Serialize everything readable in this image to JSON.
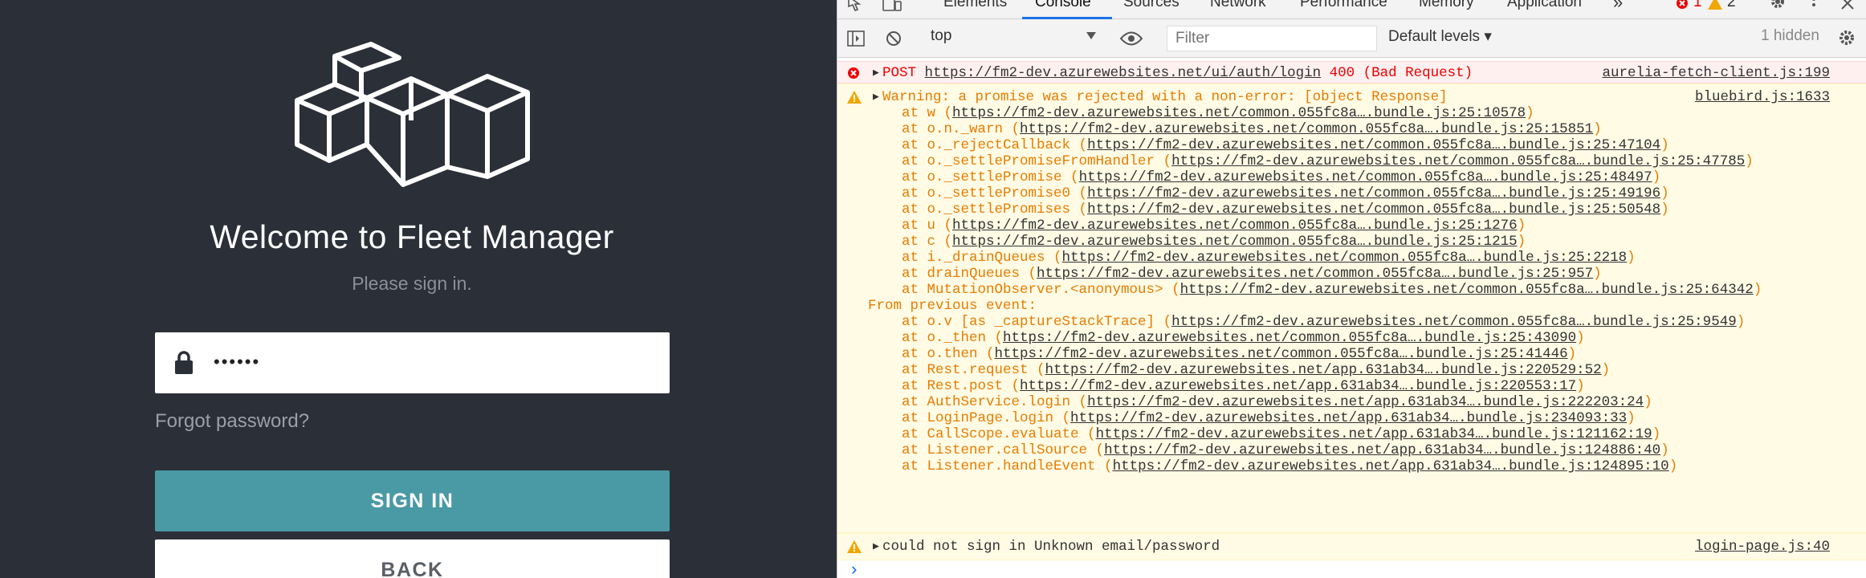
{
  "app": {
    "welcome": "Welcome to Fleet Manager",
    "subtitle": "Please sign in.",
    "password_value": "••••••",
    "forgot_password": "Forgot password?",
    "signin_label": "SIGN IN",
    "back_label": "BACK",
    "colors": {
      "background": "#2b2f37",
      "accent": "#4a9aa5"
    }
  },
  "devtools": {
    "tabs": [
      "Elements",
      "Console",
      "Sources",
      "Network",
      "Performance",
      "Memory",
      "Application"
    ],
    "active_tab": "Console",
    "more_tabs": "»",
    "error_count": "1",
    "warning_count": "2",
    "toolbar": {
      "context": "top",
      "filter_placeholder": "Filter",
      "levels": "Default levels ▾",
      "hidden": "1 hidden"
    },
    "messages": {
      "error1": {
        "method": "POST",
        "url": "https://fm2-dev.azurewebsites.net/ui/auth/login",
        "status": "400 (Bad Request)",
        "source": "aurelia-fetch-client.js:199"
      },
      "warn1": {
        "text": "Warning: a promise was rejected with a non-error: [object Response]",
        "source": "bluebird.js:1633",
        "stack": [
          {
            "fn": "at w",
            "url": "https://fm2-dev.azurewebsites.net/common.055fc8a….bundle.js:25:10578"
          },
          {
            "fn": "at o.n._warn",
            "url": "https://fm2-dev.azurewebsites.net/common.055fc8a….bundle.js:25:15851"
          },
          {
            "fn": "at o._rejectCallback",
            "url": "https://fm2-dev.azurewebsites.net/common.055fc8a….bundle.js:25:47104"
          },
          {
            "fn": "at o._settlePromiseFromHandler",
            "url": "https://fm2-dev.azurewebsites.net/common.055fc8a….bundle.js:25:47785"
          },
          {
            "fn": "at o._settlePromise",
            "url": "https://fm2-dev.azurewebsites.net/common.055fc8a….bundle.js:25:48497"
          },
          {
            "fn": "at o._settlePromise0",
            "url": "https://fm2-dev.azurewebsites.net/common.055fc8a….bundle.js:25:49196"
          },
          {
            "fn": "at o._settlePromises",
            "url": "https://fm2-dev.azurewebsites.net/common.055fc8a….bundle.js:25:50548"
          },
          {
            "fn": "at u",
            "url": "https://fm2-dev.azurewebsites.net/common.055fc8a….bundle.js:25:1276"
          },
          {
            "fn": "at c",
            "url": "https://fm2-dev.azurewebsites.net/common.055fc8a….bundle.js:25:1215"
          },
          {
            "fn": "at i._drainQueues",
            "url": "https://fm2-dev.azurewebsites.net/common.055fc8a….bundle.js:25:2218"
          },
          {
            "fn": "at drainQueues",
            "url": "https://fm2-dev.azurewebsites.net/common.055fc8a….bundle.js:25:957"
          },
          {
            "fn": "at MutationObserver.<anonymous>",
            "url": "https://fm2-dev.azurewebsites.net/common.055fc8a….bundle.js:25:64342"
          }
        ],
        "previous_label": "From previous event:",
        "previous_stack": [
          {
            "fn": "at o.v [as _captureStackTrace]",
            "url": "https://fm2-dev.azurewebsites.net/common.055fc8a….bundle.js:25:9549"
          },
          {
            "fn": "at o._then",
            "url": "https://fm2-dev.azurewebsites.net/common.055fc8a….bundle.js:25:43090"
          },
          {
            "fn": "at o.then",
            "url": "https://fm2-dev.azurewebsites.net/common.055fc8a….bundle.js:25:41446"
          },
          {
            "fn": "at Rest.request",
            "url": "https://fm2-dev.azurewebsites.net/app.631ab34….bundle.js:220529:52"
          },
          {
            "fn": "at Rest.post",
            "url": "https://fm2-dev.azurewebsites.net/app.631ab34….bundle.js:220553:17"
          },
          {
            "fn": "at AuthService.login",
            "url": "https://fm2-dev.azurewebsites.net/app.631ab34….bundle.js:222203:24"
          },
          {
            "fn": "at LoginPage.login",
            "url": "https://fm2-dev.azurewebsites.net/app.631ab34….bundle.js:234093:33"
          },
          {
            "fn": "at CallScope.evaluate",
            "url": "https://fm2-dev.azurewebsites.net/app.631ab34….bundle.js:121162:19"
          },
          {
            "fn": "at Listener.callSource",
            "url": "https://fm2-dev.azurewebsites.net/app.631ab34….bundle.js:124886:40"
          },
          {
            "fn": "at Listener.handleEvent",
            "url": "https://fm2-dev.azurewebsites.net/app.631ab34….bundle.js:124895:10"
          }
        ]
      },
      "warn2": {
        "text": "could not sign in Unknown email/password",
        "source": "login-page.js:40"
      }
    },
    "prompt": "›"
  }
}
